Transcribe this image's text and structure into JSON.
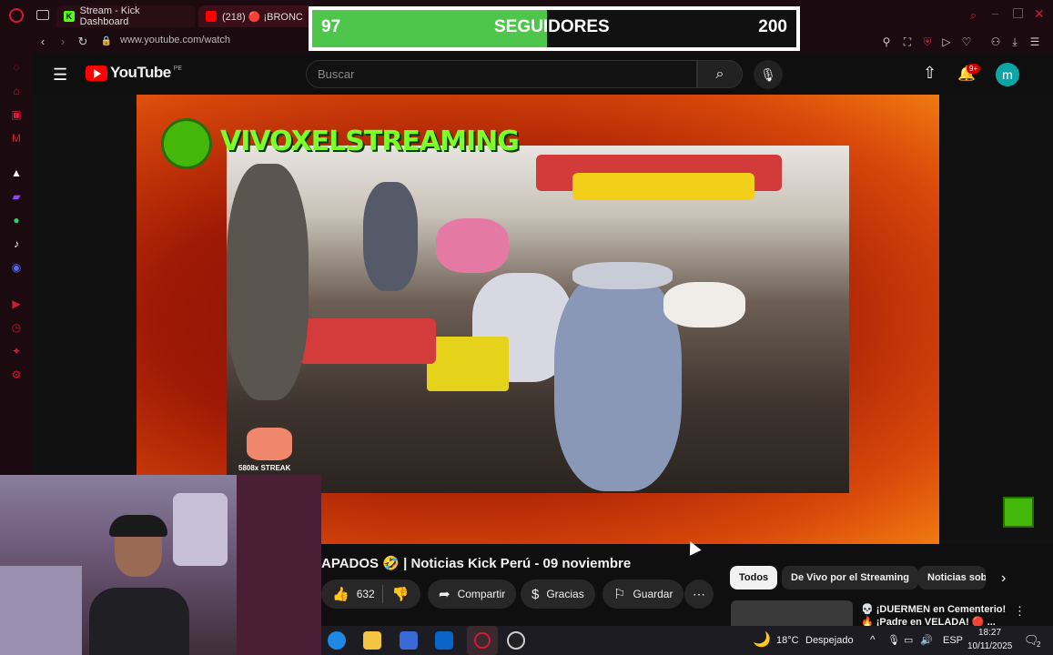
{
  "browser": {
    "tabs": [
      {
        "label": "Stream - Kick Dashboard",
        "icon": "kick-icon"
      },
      {
        "label": "(218) 🔴 ¡BRONC",
        "icon": "youtube-icon"
      }
    ],
    "url": "www.youtube.com/watch"
  },
  "followers_overlay": {
    "current": "97",
    "label": "SEGUIDORES",
    "goal": "200",
    "progress_fraction": 0.485,
    "colors": {
      "fill": "#4ec64b",
      "track": "#111111"
    }
  },
  "youtube": {
    "logo_text": "YouTube",
    "country": "PE",
    "search_placeholder": "Buscar",
    "notifications_badge": "9+",
    "avatar_letter": "m"
  },
  "video": {
    "channel_overlay": "VIVOXELSTREAMING",
    "streak_text": "5808x STREAK",
    "title": "APADOS 🤣 | Noticias Kick Perú - 09 noviembre"
  },
  "actions": {
    "likes": "632",
    "share": "Compartir",
    "thanks": "Gracias",
    "save": "Guardar"
  },
  "chips": [
    "Todos",
    "De Vivo por el Streaming",
    "Noticias sob"
  ],
  "related": {
    "line1": "💀 ¡DUERMEN en Cementerio!",
    "line2": "🔥 ¡Padre en VELADA! 🔴 ..."
  },
  "taskbar": {
    "weather": "18°C",
    "weather_desc": "Despejado",
    "lang": "ESP",
    "time": "18:27",
    "date": "10/11/2025",
    "notif_count": "2"
  },
  "colors": {
    "accent_red": "#ff0000",
    "kick_green": "#53fc18"
  }
}
